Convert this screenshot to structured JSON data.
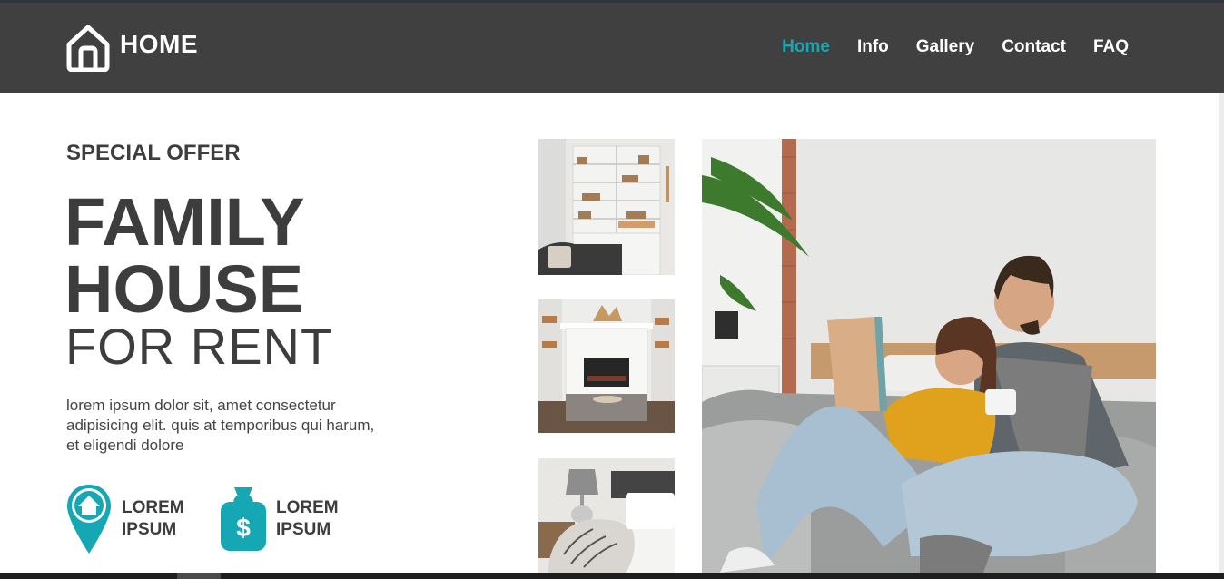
{
  "brand": {
    "name": "HOME",
    "icon": "house-outline-icon"
  },
  "nav": {
    "items": [
      {
        "label": "Home",
        "active": true
      },
      {
        "label": "Info",
        "active": false
      },
      {
        "label": "Gallery",
        "active": false
      },
      {
        "label": "Contact",
        "active": false
      },
      {
        "label": "FAQ",
        "active": false
      }
    ]
  },
  "hero": {
    "kicker": "SPECIAL OFFER",
    "title_line1": "FAMILY",
    "title_line2": "HOUSE",
    "title_line3": "FOR RENT",
    "description": "lorem ipsum dolor sit, amet consectetur adipisicing elit. quis at temporibus qui harum, et eligendi dolore"
  },
  "features": [
    {
      "icon": "home-location-pin-icon",
      "line1": "LOREM",
      "line2": "IPSUM"
    },
    {
      "icon": "money-bag-icon",
      "line1": "LOREM",
      "line2": "IPSUM"
    }
  ],
  "gallery": [
    {
      "name": "living-room-shelves-photo"
    },
    {
      "name": "fireplace-room-photo"
    },
    {
      "name": "bedroom-lamp-photo"
    },
    {
      "name": "couple-on-sofa-photo"
    }
  ],
  "colors": {
    "navbar": "#404040",
    "accent": "#16a7b5",
    "text": "#3d3d3d",
    "white": "#ffffff"
  }
}
